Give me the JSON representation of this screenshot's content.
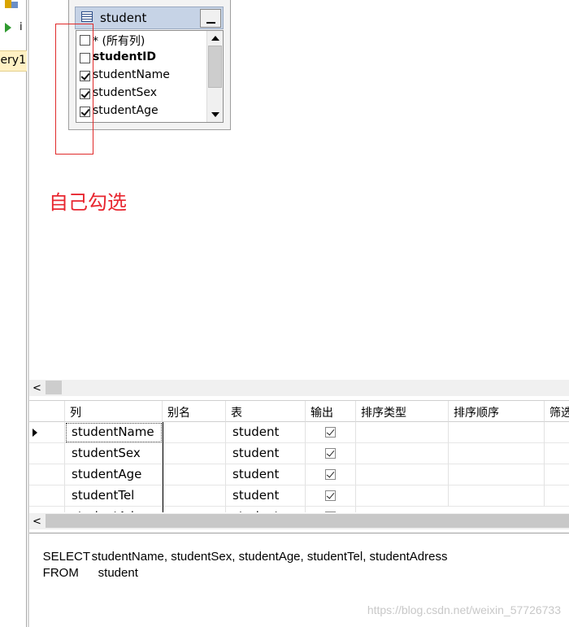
{
  "left_strip": {
    "run_label": "i",
    "tab_label": "ery1"
  },
  "table_box": {
    "title": "student",
    "columns": [
      {
        "label": "* (所有列)",
        "checked": false,
        "bold": false
      },
      {
        "label": "studentID",
        "checked": false,
        "bold": true
      },
      {
        "label": "studentName",
        "checked": true,
        "bold": false
      },
      {
        "label": "studentSex",
        "checked": true,
        "bold": false
      },
      {
        "label": "studentAge",
        "checked": true,
        "bold": false
      }
    ]
  },
  "annotation": "自己勾选",
  "grid": {
    "headers": [
      "列",
      "别名",
      "表",
      "输出",
      "排序类型",
      "排序顺序",
      "筛选"
    ],
    "rows": [
      {
        "column": "studentName",
        "alias": "",
        "table": "student",
        "output": true
      },
      {
        "column": "studentSex",
        "alias": "",
        "table": "student",
        "output": true
      },
      {
        "column": "studentAge",
        "alias": "",
        "table": "student",
        "output": true
      },
      {
        "column": "studentTel",
        "alias": "",
        "table": "student",
        "output": true
      },
      {
        "column": "studentAdress",
        "alias": "",
        "table": "student",
        "output": true
      }
    ]
  },
  "sql": {
    "select_kw": "SELECT",
    "select_cols": "studentName, studentSex, studentAge, studentTel, studentAdress",
    "from_kw": "FROM",
    "from_table": "student"
  },
  "watermark": "https://blog.csdn.net/weixin_57726733",
  "colors": {
    "annotation": "#e8262f",
    "red_box": "#e02a2a",
    "title_bar": "#c6d3e6",
    "tab_highlight": "#fff1c4"
  }
}
